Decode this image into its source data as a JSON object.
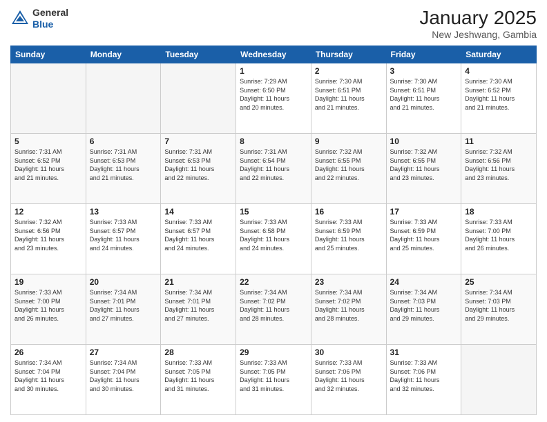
{
  "header": {
    "logo": {
      "general": "General",
      "blue": "Blue"
    },
    "title": "January 2025",
    "location": "New Jeshwang, Gambia"
  },
  "days": [
    "Sunday",
    "Monday",
    "Tuesday",
    "Wednesday",
    "Thursday",
    "Friday",
    "Saturday"
  ],
  "weeks": [
    [
      {
        "day": "",
        "content": ""
      },
      {
        "day": "",
        "content": ""
      },
      {
        "day": "",
        "content": ""
      },
      {
        "day": "1",
        "content": "Sunrise: 7:29 AM\nSunset: 6:50 PM\nDaylight: 11 hours\nand 20 minutes."
      },
      {
        "day": "2",
        "content": "Sunrise: 7:30 AM\nSunset: 6:51 PM\nDaylight: 11 hours\nand 21 minutes."
      },
      {
        "day": "3",
        "content": "Sunrise: 7:30 AM\nSunset: 6:51 PM\nDaylight: 11 hours\nand 21 minutes."
      },
      {
        "day": "4",
        "content": "Sunrise: 7:30 AM\nSunset: 6:52 PM\nDaylight: 11 hours\nand 21 minutes."
      }
    ],
    [
      {
        "day": "5",
        "content": "Sunrise: 7:31 AM\nSunset: 6:52 PM\nDaylight: 11 hours\nand 21 minutes."
      },
      {
        "day": "6",
        "content": "Sunrise: 7:31 AM\nSunset: 6:53 PM\nDaylight: 11 hours\nand 21 minutes."
      },
      {
        "day": "7",
        "content": "Sunrise: 7:31 AM\nSunset: 6:53 PM\nDaylight: 11 hours\nand 22 minutes."
      },
      {
        "day": "8",
        "content": "Sunrise: 7:31 AM\nSunset: 6:54 PM\nDaylight: 11 hours\nand 22 minutes."
      },
      {
        "day": "9",
        "content": "Sunrise: 7:32 AM\nSunset: 6:55 PM\nDaylight: 11 hours\nand 22 minutes."
      },
      {
        "day": "10",
        "content": "Sunrise: 7:32 AM\nSunset: 6:55 PM\nDaylight: 11 hours\nand 23 minutes."
      },
      {
        "day": "11",
        "content": "Sunrise: 7:32 AM\nSunset: 6:56 PM\nDaylight: 11 hours\nand 23 minutes."
      }
    ],
    [
      {
        "day": "12",
        "content": "Sunrise: 7:32 AM\nSunset: 6:56 PM\nDaylight: 11 hours\nand 23 minutes."
      },
      {
        "day": "13",
        "content": "Sunrise: 7:33 AM\nSunset: 6:57 PM\nDaylight: 11 hours\nand 24 minutes."
      },
      {
        "day": "14",
        "content": "Sunrise: 7:33 AM\nSunset: 6:57 PM\nDaylight: 11 hours\nand 24 minutes."
      },
      {
        "day": "15",
        "content": "Sunrise: 7:33 AM\nSunset: 6:58 PM\nDaylight: 11 hours\nand 24 minutes."
      },
      {
        "day": "16",
        "content": "Sunrise: 7:33 AM\nSunset: 6:59 PM\nDaylight: 11 hours\nand 25 minutes."
      },
      {
        "day": "17",
        "content": "Sunrise: 7:33 AM\nSunset: 6:59 PM\nDaylight: 11 hours\nand 25 minutes."
      },
      {
        "day": "18",
        "content": "Sunrise: 7:33 AM\nSunset: 7:00 PM\nDaylight: 11 hours\nand 26 minutes."
      }
    ],
    [
      {
        "day": "19",
        "content": "Sunrise: 7:33 AM\nSunset: 7:00 PM\nDaylight: 11 hours\nand 26 minutes."
      },
      {
        "day": "20",
        "content": "Sunrise: 7:34 AM\nSunset: 7:01 PM\nDaylight: 11 hours\nand 27 minutes."
      },
      {
        "day": "21",
        "content": "Sunrise: 7:34 AM\nSunset: 7:01 PM\nDaylight: 11 hours\nand 27 minutes."
      },
      {
        "day": "22",
        "content": "Sunrise: 7:34 AM\nSunset: 7:02 PM\nDaylight: 11 hours\nand 28 minutes."
      },
      {
        "day": "23",
        "content": "Sunrise: 7:34 AM\nSunset: 7:02 PM\nDaylight: 11 hours\nand 28 minutes."
      },
      {
        "day": "24",
        "content": "Sunrise: 7:34 AM\nSunset: 7:03 PM\nDaylight: 11 hours\nand 29 minutes."
      },
      {
        "day": "25",
        "content": "Sunrise: 7:34 AM\nSunset: 7:03 PM\nDaylight: 11 hours\nand 29 minutes."
      }
    ],
    [
      {
        "day": "26",
        "content": "Sunrise: 7:34 AM\nSunset: 7:04 PM\nDaylight: 11 hours\nand 30 minutes."
      },
      {
        "day": "27",
        "content": "Sunrise: 7:34 AM\nSunset: 7:04 PM\nDaylight: 11 hours\nand 30 minutes."
      },
      {
        "day": "28",
        "content": "Sunrise: 7:33 AM\nSunset: 7:05 PM\nDaylight: 11 hours\nand 31 minutes."
      },
      {
        "day": "29",
        "content": "Sunrise: 7:33 AM\nSunset: 7:05 PM\nDaylight: 11 hours\nand 31 minutes."
      },
      {
        "day": "30",
        "content": "Sunrise: 7:33 AM\nSunset: 7:06 PM\nDaylight: 11 hours\nand 32 minutes."
      },
      {
        "day": "31",
        "content": "Sunrise: 7:33 AM\nSunset: 7:06 PM\nDaylight: 11 hours\nand 32 minutes."
      },
      {
        "day": "",
        "content": ""
      }
    ]
  ]
}
